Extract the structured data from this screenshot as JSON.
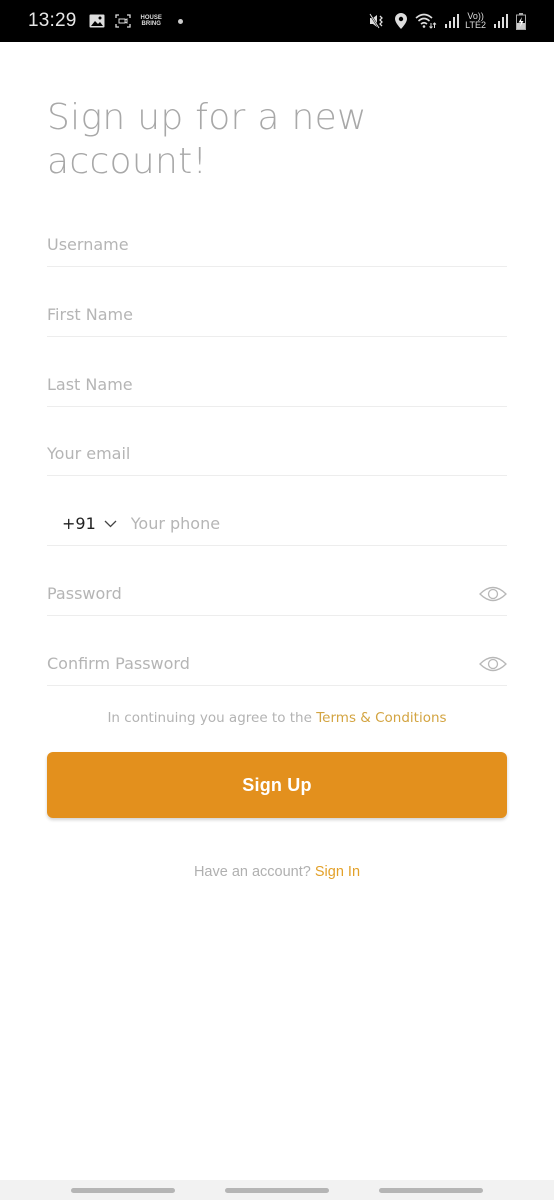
{
  "status_bar": {
    "time": "13:29",
    "left_icons": [
      "gallery-icon",
      "screen-record-icon",
      "house-bring-icon",
      "notification-dot-icon"
    ],
    "app_badge_text": [
      "HOUSE",
      "BRING"
    ],
    "right_icons": [
      "mute-vibrate-icon",
      "location-icon",
      "wifi-icon",
      "signal-icon",
      "volte-icon",
      "signal-icon",
      "battery-charging-icon"
    ],
    "volte_text": [
      "Vo))",
      "LTE2"
    ]
  },
  "title": "Sign up for a new account!",
  "form": {
    "username": {
      "placeholder": "Username",
      "value": ""
    },
    "first_name": {
      "placeholder": "First Name",
      "value": ""
    },
    "last_name": {
      "placeholder": "Last Name",
      "value": ""
    },
    "email": {
      "placeholder": "Your email",
      "value": ""
    },
    "phone": {
      "country_code": "+91",
      "placeholder": "Your phone",
      "value": ""
    },
    "password": {
      "placeholder": "Password",
      "value": ""
    },
    "confirm_password": {
      "placeholder": "Confirm Password",
      "value": ""
    }
  },
  "terms": {
    "prefix": "In continuing you agree to the",
    "link": "Terms & Conditions"
  },
  "signup_button": "Sign Up",
  "signin": {
    "prefix": "Have an account?",
    "link": "Sign In"
  },
  "colors": {
    "accent": "#e3901d",
    "link": "#d3a441",
    "placeholder": "#b5b5b5",
    "title": "#a8a8a8"
  }
}
